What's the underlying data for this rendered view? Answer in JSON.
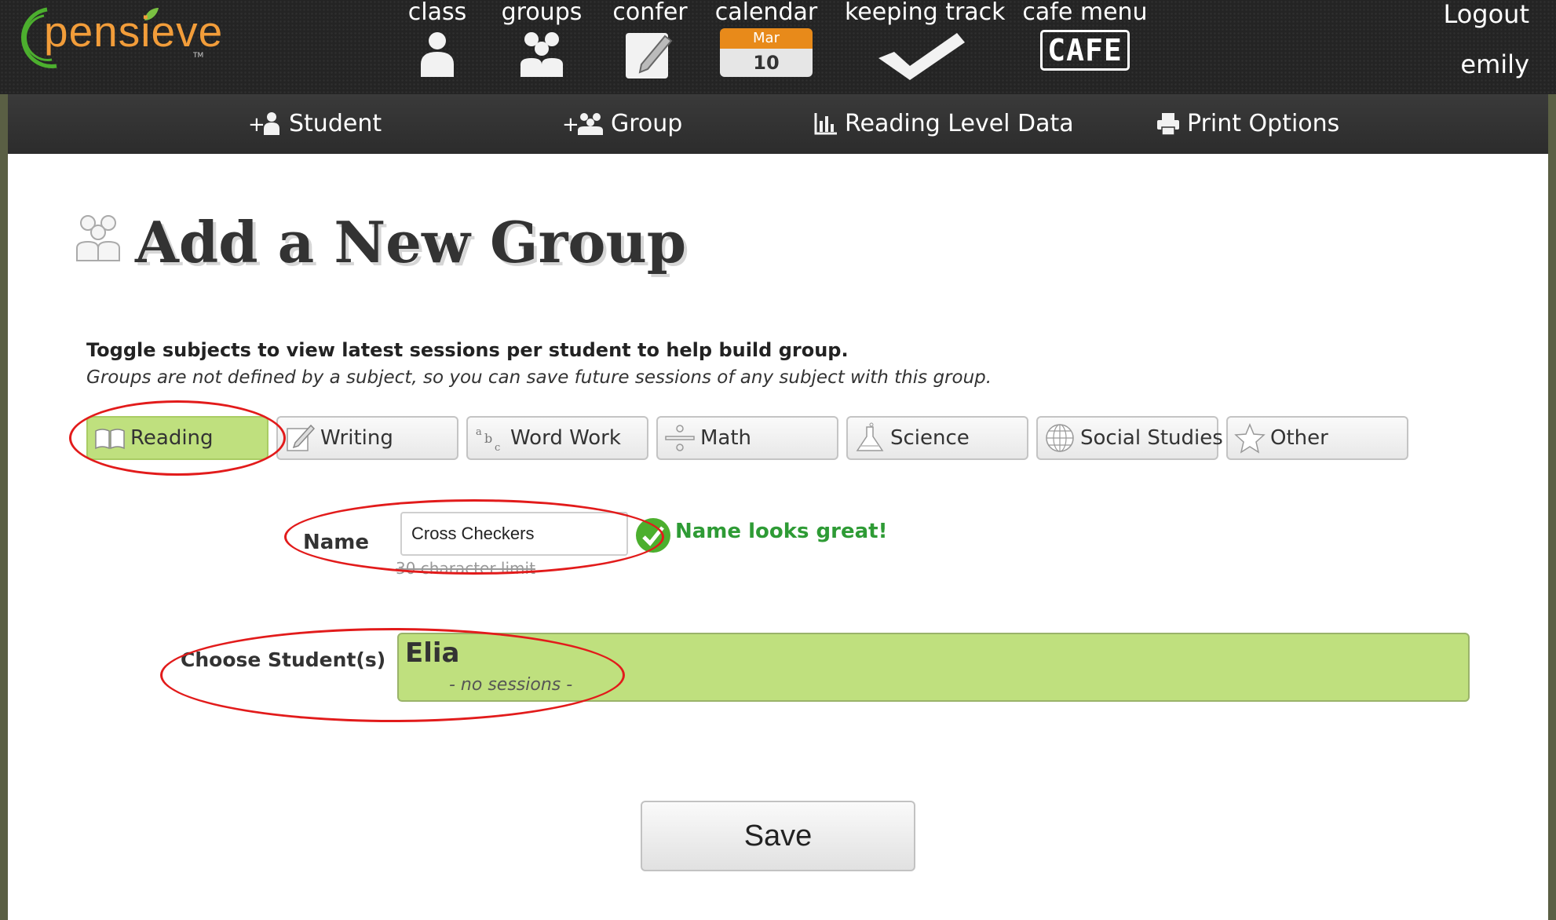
{
  "app": {
    "logo_text": "pensieve",
    "logo_tm": "TM"
  },
  "topnav": [
    {
      "label": "class",
      "icon": "person-icon"
    },
    {
      "label": "groups",
      "icon": "group-icon"
    },
    {
      "label": "confer",
      "icon": "notepad-pencil-icon"
    },
    {
      "label": "calendar",
      "icon": "calendar-icon",
      "month": "Mar",
      "day": "10"
    },
    {
      "label": "keeping track",
      "icon": "checkmark-icon"
    },
    {
      "label": "cafe menu",
      "icon": "cafe-icon",
      "badge": "CAFE"
    }
  ],
  "account": {
    "logout": "Logout",
    "username": "emily"
  },
  "actions": [
    {
      "label": "Student",
      "icon": "add-student-icon"
    },
    {
      "label": "Group",
      "icon": "add-group-icon"
    },
    {
      "label": "Reading Level Data",
      "icon": "bar-chart-icon"
    },
    {
      "label": "Print Options",
      "icon": "printer-icon"
    }
  ],
  "page": {
    "title": "Add a New Group"
  },
  "instructions": {
    "main": "Toggle subjects to view latest sessions per student to help build group.",
    "sub": "Groups are not defined by a subject, so you can save future sessions of any subject with this group."
  },
  "subjects": [
    {
      "label": "Reading",
      "icon": "book-icon",
      "active": true
    },
    {
      "label": "Writing",
      "icon": "paper-pencil-icon",
      "active": false
    },
    {
      "label": "Word Work",
      "icon": "abc-icon",
      "active": false
    },
    {
      "label": "Math",
      "icon": "divide-icon",
      "active": false
    },
    {
      "label": "Science",
      "icon": "flask-icon",
      "active": false
    },
    {
      "label": "Social Studies",
      "icon": "globe-icon",
      "active": false
    },
    {
      "label": "Other",
      "icon": "star-icon",
      "active": false
    }
  ],
  "form": {
    "name_label": "Name",
    "name_value": "Cross Checkers",
    "char_limit": "30 character limit",
    "name_status": "Name looks great!",
    "students_label": "Choose Student(s)",
    "students": [
      {
        "name": "Elia",
        "sessions": "- no sessions -"
      }
    ],
    "save_label": "Save"
  },
  "colors": {
    "active_subject": "#bfe07e",
    "success_text": "#2e9b35",
    "annotation_circle": "#e21b1b",
    "calendar_month": "#e88a1a",
    "logo_orange": "#f29d3a",
    "logo_green": "#4caf2e"
  }
}
